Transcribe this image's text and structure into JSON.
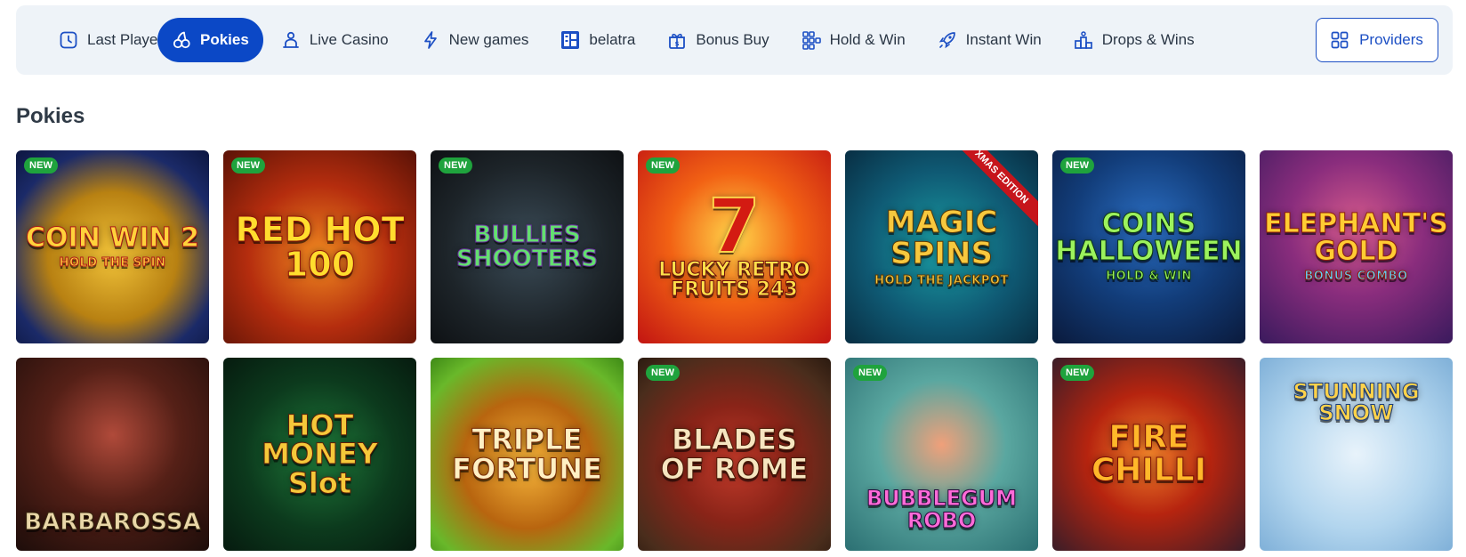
{
  "nav": {
    "items": [
      {
        "label": "Last Played",
        "icon": "clock-icon"
      },
      {
        "label": "Pokies",
        "icon": "cherries-icon",
        "active": true
      },
      {
        "label": "Live Casino",
        "icon": "dealer-icon"
      },
      {
        "label": "New games",
        "icon": "lightning-icon"
      },
      {
        "label": "belatra",
        "icon": "belatra-logo-icon"
      },
      {
        "label": "Bonus Buy",
        "icon": "gift-icon"
      },
      {
        "label": "Hold & Win",
        "icon": "dots-grid-icon"
      },
      {
        "label": "Instant Win",
        "icon": "rocket-icon"
      },
      {
        "label": "Drops & Wins",
        "icon": "podium-icon"
      }
    ],
    "providers_label": "Providers",
    "accent": "#0b48c6"
  },
  "section": {
    "title": "Pokies"
  },
  "games": [
    {
      "name": "COIN WIN 2",
      "sub": "HOLD THE SPIN",
      "badge": "NEW"
    },
    {
      "name": "RED HOT 100",
      "sub": "",
      "badge": "NEW"
    },
    {
      "name": "BULLIES SHOOTERS",
      "sub": "",
      "badge": "NEW"
    },
    {
      "name": "LUCKY RETRO FRUITS 243",
      "sub": "",
      "badge": "NEW",
      "big": "7"
    },
    {
      "name": "MAGIC SPINS",
      "sub": "HOLD THE JACKPOT",
      "badge": "",
      "ribbon": "XMAS EDITION"
    },
    {
      "name": "COINS HALLOWEEN",
      "sub": "HOLD & WIN",
      "badge": "NEW"
    },
    {
      "name": "ELEPHANT'S GOLD",
      "sub": "BONUS COMBO",
      "badge": ""
    },
    {
      "name": "BARBAROSSA",
      "sub": "",
      "badge": ""
    },
    {
      "name": "HOT MONEY Slot",
      "sub": "",
      "badge": ""
    },
    {
      "name": "TRIPLE FORTUNE",
      "sub": "",
      "badge": ""
    },
    {
      "name": "BLADES OF ROME",
      "sub": "",
      "badge": "NEW"
    },
    {
      "name": "BUBBLEGUM ROBO",
      "sub": "",
      "badge": "NEW"
    },
    {
      "name": "FIRE CHILLI",
      "sub": "",
      "badge": "NEW"
    },
    {
      "name": "STUNNING SNOW",
      "sub": "",
      "badge": ""
    }
  ]
}
